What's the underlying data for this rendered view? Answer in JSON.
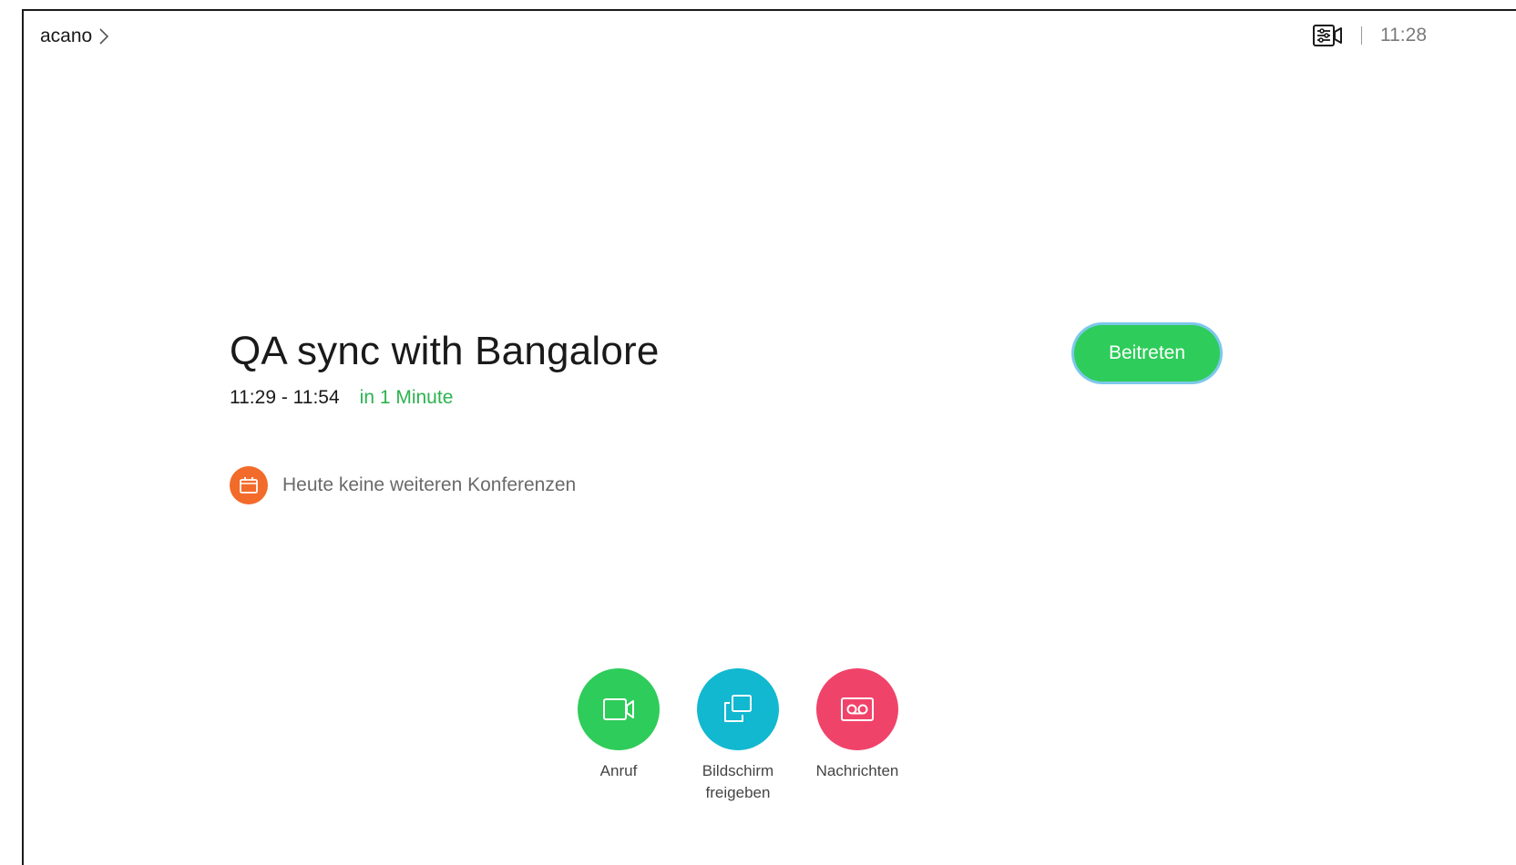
{
  "header": {
    "device_name": "acano",
    "clock": "11:28"
  },
  "meeting": {
    "title": "QA sync with Bangalore",
    "time": "11:29 - 11:54",
    "relative": "in 1 Minute",
    "join_label": "Beitreten"
  },
  "agenda": {
    "empty_text": "Heute keine weiteren Konferenzen"
  },
  "actions": [
    {
      "label": "Anruf",
      "icon": "video-camera-icon",
      "color": "#2ecc5a"
    },
    {
      "label": "Bildschirm freigeben",
      "icon": "share-screen-icon",
      "color": "#11b8d0"
    },
    {
      "label": "Nachrichten",
      "icon": "voicemail-icon",
      "color": "#f0436a"
    }
  ],
  "colors": {
    "join": "#2ecc5a",
    "join_focus": "#7cc8ea",
    "relative_time": "#2bb34f",
    "calendar_badge": "#f26b2a"
  }
}
